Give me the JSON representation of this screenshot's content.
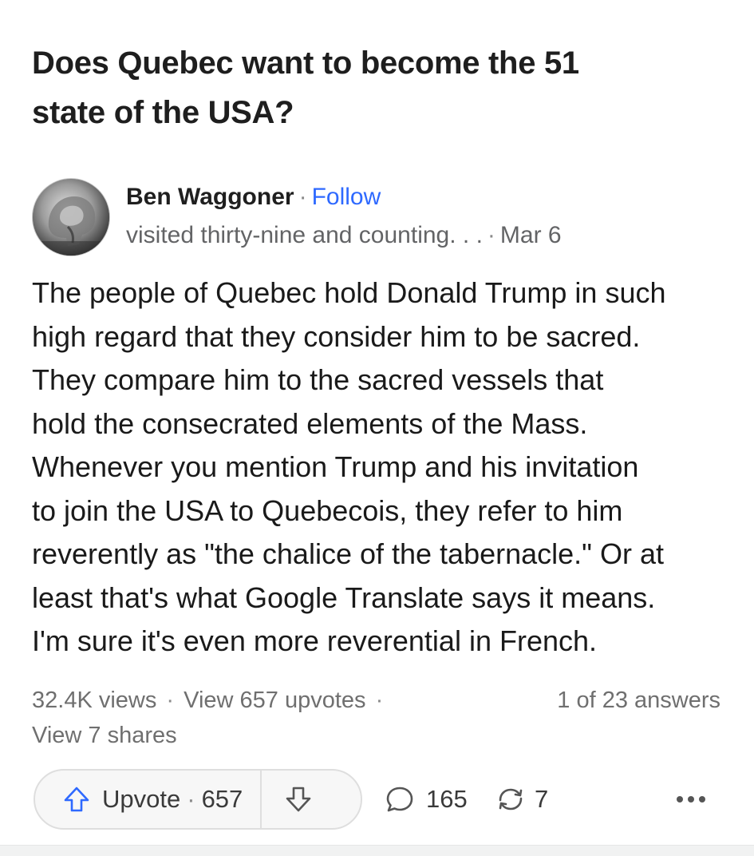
{
  "question": {
    "title_line1": "Does Quebec want to become the 51",
    "title_line2": "state of the USA?"
  },
  "author": {
    "name": "Ben Waggoner",
    "separator": "·",
    "follow_label": "Follow",
    "credential": "visited thirty-nine and counting. . .",
    "date": "Mar 6"
  },
  "answer": {
    "lines": [
      "The people of Quebec hold Donald Trump in such",
      "high regard that they consider him to be sacred.",
      "They compare him to the sacred vessels that",
      "hold the consecrated elements of the Mass.",
      "Whenever you mention Trump and his invitation",
      "to join the USA to Quebecois, they refer to him",
      "reverently as \"the chalice of the tabernacle.\" Or at",
      "least that's what Google Translate says it means.",
      "I'm sure it's even more reverential in French."
    ]
  },
  "meta": {
    "views": "32.4K views",
    "upvotes_link": "View 657 upvotes",
    "shares_link": "View 7 shares",
    "answer_position": "1 of 23 answers",
    "separator": "·"
  },
  "actions": {
    "upvote_label": "Upvote",
    "upvote_count": "657",
    "comment_count": "165",
    "share_count": "7",
    "icons": {
      "upvote": "upvote-arrow-icon",
      "downvote": "downvote-arrow-icon",
      "comment": "comment-bubble-icon",
      "share": "share-arrows-icon",
      "more": "more-dots-icon"
    }
  },
  "colors": {
    "follow_link": "#2e69ff",
    "text_primary": "#1a1a1a",
    "text_secondary": "#636466"
  }
}
